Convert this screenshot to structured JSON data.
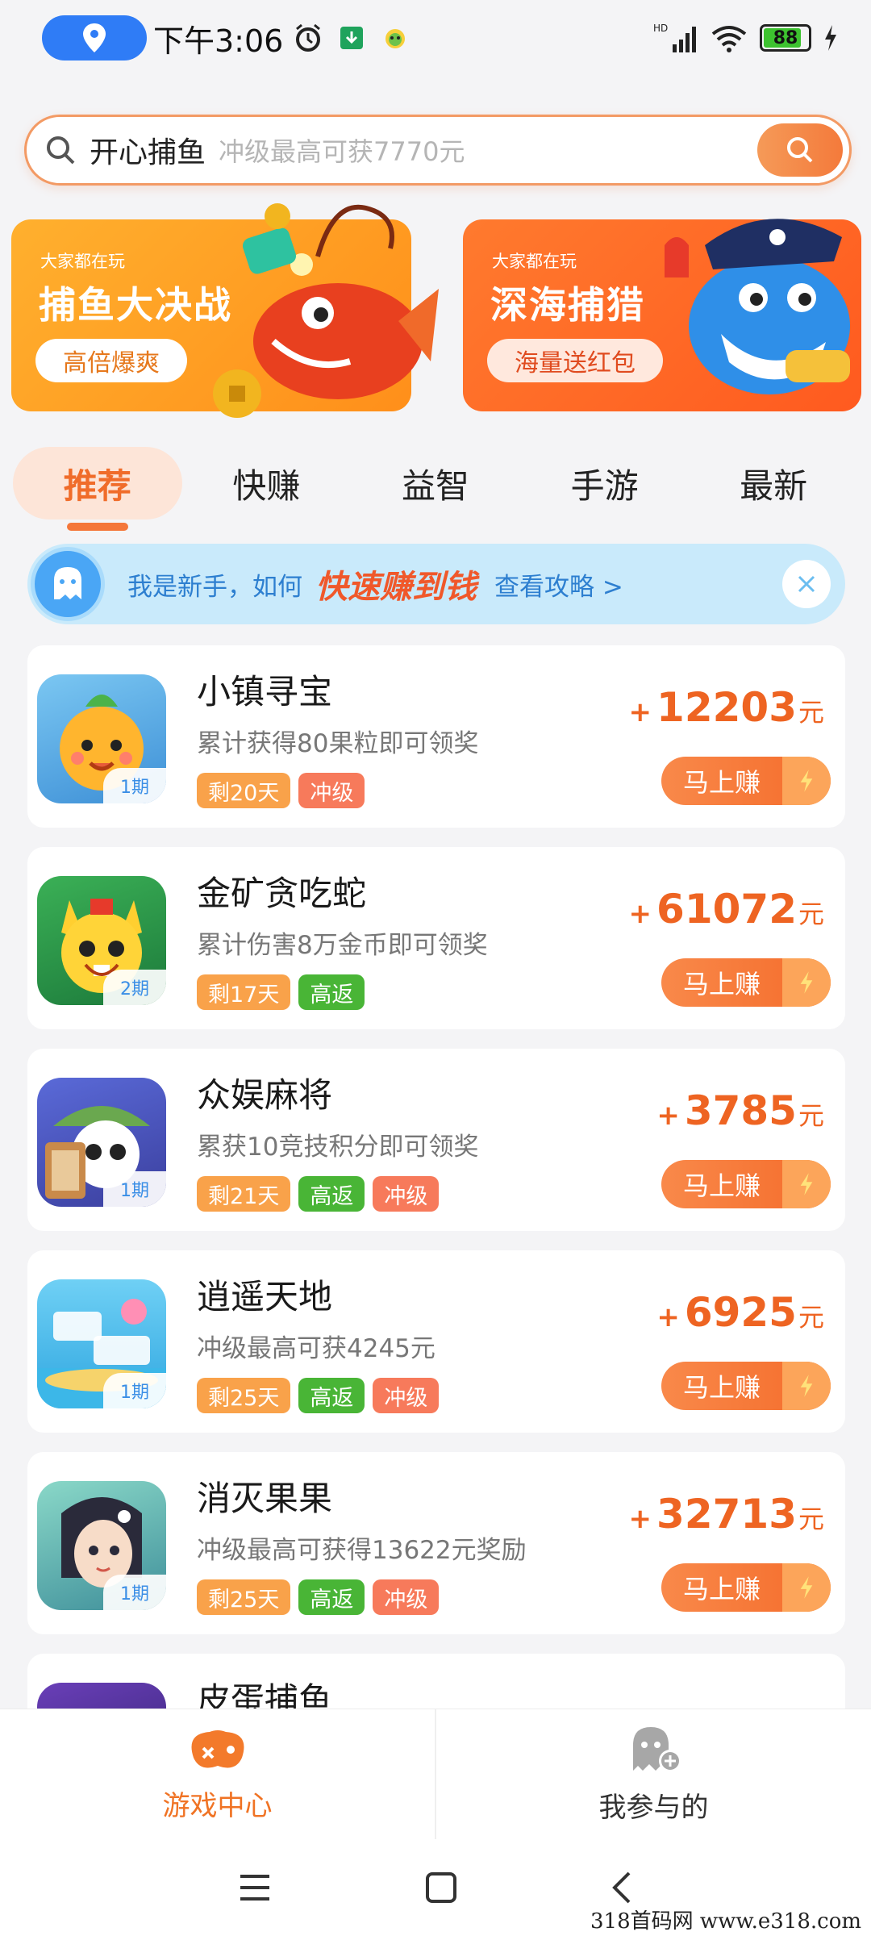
{
  "status_bar": {
    "time": "下午3:06",
    "battery": "88"
  },
  "search": {
    "term": "开心捕鱼",
    "hint": "冲级最高可获7770元"
  },
  "banners": [
    {
      "kicker": "大家都在玩",
      "title": "捕鱼大决战",
      "pill": "高倍爆爽"
    },
    {
      "kicker": "大家都在玩",
      "title": "深海捕猎",
      "pill": "海量送红包"
    }
  ],
  "tabs": [
    "推荐",
    "快赚",
    "益智",
    "手游",
    "最新"
  ],
  "guide": {
    "text": "我是新手，如何",
    "strong": "快速赚到钱",
    "link": "查看攻略 >"
  },
  "games": [
    {
      "name": "小镇寻宝",
      "desc": "累计获得80果粒即可领奖",
      "period": "1期",
      "tags": [
        "剩20天",
        "冲级"
      ],
      "plus": "+",
      "reward": "12203",
      "unit": "元",
      "button": "马上赚"
    },
    {
      "name": "金矿贪吃蛇",
      "desc": "累计伤害8万金币即可领奖",
      "period": "2期",
      "tags": [
        "剩17天",
        "高返"
      ],
      "plus": "+",
      "reward": "61072",
      "unit": "元",
      "button": "马上赚"
    },
    {
      "name": "众娱麻将",
      "desc": "累获10竞技积分即可领奖",
      "period": "1期",
      "tags": [
        "剩21天",
        "高返",
        "冲级"
      ],
      "plus": "+",
      "reward": "3785",
      "unit": "元",
      "button": "马上赚"
    },
    {
      "name": "逍遥天地",
      "desc": "冲级最高可获4245元",
      "period": "1期",
      "tags": [
        "剩25天",
        "高返",
        "冲级"
      ],
      "plus": "+",
      "reward": "6925",
      "unit": "元",
      "button": "马上赚"
    },
    {
      "name": "消灭果果",
      "desc": "冲级最高可获得13622元奖励",
      "period": "1期",
      "tags": [
        "剩25天",
        "高返",
        "冲级"
      ],
      "plus": "+",
      "reward": "32713",
      "unit": "元",
      "button": "马上赚"
    },
    {
      "name": "皮蛋捕鱼"
    }
  ],
  "bottom_nav": [
    "游戏中心",
    "我参与的"
  ],
  "watermark": "318首码网 www.e318.com"
}
